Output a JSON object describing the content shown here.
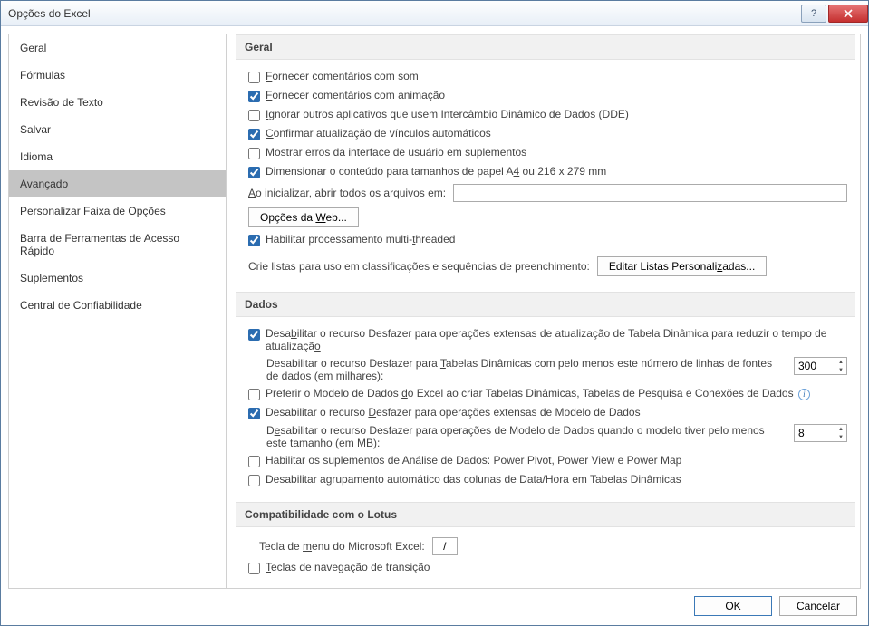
{
  "window": {
    "title": "Opções do Excel"
  },
  "sidebar": {
    "items": [
      {
        "label": "Geral"
      },
      {
        "label": "Fórmulas"
      },
      {
        "label": "Revisão de Texto"
      },
      {
        "label": "Salvar"
      },
      {
        "label": "Idioma"
      },
      {
        "label": "Avançado"
      },
      {
        "label": "Personalizar Faixa de Opções"
      },
      {
        "label": "Barra de Ferramentas de Acesso Rápido"
      },
      {
        "label": "Suplementos"
      },
      {
        "label": "Central de Confiabilidade"
      }
    ],
    "selected_index": 5
  },
  "sections": {
    "geral": {
      "title": "Geral",
      "sound": {
        "label": "Fornecer comentários com som",
        "checked": false
      },
      "animation": {
        "label": "Fornecer comentários com animação",
        "checked": true
      },
      "dde": {
        "label": "Ignorar outros aplicativos que usem Intercâmbio Dinâmico de Dados (DDE)",
        "checked": false
      },
      "links": {
        "label": "Confirmar atualização de vínculos automáticos",
        "checked": true
      },
      "addin_err": {
        "label": "Mostrar erros da interface de usuário em suplementos",
        "checked": false
      },
      "scale_a4": {
        "label": "Dimensionar o conteúdo para tamanhos de papel A4 ou 216 x 279 mm",
        "checked": true
      },
      "startup_label": "Ao inicializar, abrir todos os arquivos em:",
      "startup_value": "",
      "web_options": "Opções da Web...",
      "multithread": {
        "label": "Habilitar processamento multi-threaded",
        "checked": true
      },
      "custom_lists_label": "Crie listas para uso em classificações e sequências de preenchimento:",
      "custom_lists_btn": "Editar Listas Personalizadas..."
    },
    "dados": {
      "title": "Dados",
      "undo_pivot_refresh": {
        "label": "Desabilitar o recurso Desfazer para operações extensas de atualização de Tabela Dinâmica para reduzir o tempo de atualização",
        "checked": true
      },
      "pivot_rows_label": "Desabilitar o recurso Desfazer para Tabelas Dinâmicas com pelo menos este número de linhas de fontes de dados (em milhares):",
      "pivot_rows_value": "300",
      "prefer_model": {
        "label": "Preferir o Modelo de Dados do Excel ao criar Tabelas Dinâmicas, Tabelas de Pesquisa e Conexões de Dados",
        "checked": false
      },
      "undo_model": {
        "label": "Desabilitar o recurso Desfazer para operações extensas de Modelo de Dados",
        "checked": true
      },
      "model_size_label": "Desabilitar o recurso Desfazer para operações de Modelo de Dados quando o modelo tiver pelo menos este tamanho (em MB):",
      "model_size_value": "8",
      "data_analysis_addins": {
        "label": "Habilitar os suplementos de Análise de Dados: Power Pivot, Power View e Power Map",
        "checked": false
      },
      "disable_date_group": {
        "label": "Desabilitar agrupamento automático das colunas de Data/Hora em Tabelas Dinâmicas",
        "checked": false
      }
    },
    "lotus": {
      "title": "Compatibilidade com o Lotus",
      "menu_key_label": "Tecla de menu do Microsoft Excel:",
      "menu_key_value": "/",
      "transition_nav": {
        "label": "Teclas de navegação de transição",
        "checked": false
      }
    }
  },
  "footer": {
    "ok": "OK",
    "cancel": "Cancelar"
  }
}
